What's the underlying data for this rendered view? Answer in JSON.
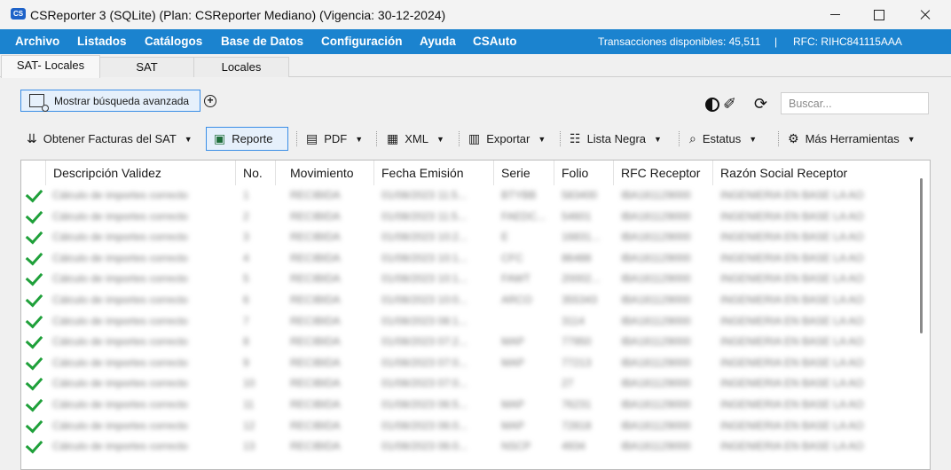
{
  "window": {
    "title": "CSReporter 3 (SQLite) (Plan: CSReporter Mediano) (Vigencia: 30-12-2024)",
    "app_icon_text": "CS"
  },
  "menu": {
    "items": [
      "Archivo",
      "Listados",
      "Catálogos",
      "Base de Datos",
      "Configuración",
      "Ayuda",
      "CSAuto"
    ],
    "transactions": "Transacciones disponibles: 45,511",
    "divider": "|",
    "rfc": "RFC: RIHC841115AAA"
  },
  "tabs": [
    "SAT- Locales",
    "SAT",
    "Locales"
  ],
  "search_row": {
    "advanced_search": "Mostrar búsqueda avanzada",
    "search_placeholder": "Buscar..."
  },
  "toolbar": {
    "items": [
      "Obtener Facturas del SAT",
      "Reporte",
      "PDF",
      "XML",
      "Exportar",
      "Lista Negra",
      "Estatus",
      "Más Herramientas"
    ]
  },
  "grid": {
    "columns": [
      "Descripción Validez",
      "No.",
      "Movimiento",
      "Fecha Emisión",
      "Serie",
      "Folio",
      "RFC Receptor",
      "Razón Social Receptor"
    ],
    "rows": [
      [
        "Cálculo de importes correcto",
        "1",
        "RECIBIDA",
        "01/08/2023 11:5...",
        "BTYBB",
        "583400",
        "IBA181129000",
        "INGENIERIA EN BASE LA AO"
      ],
      [
        "Cálculo de importes correcto",
        "2",
        "RECIBIDA",
        "01/08/2023 11:5...",
        "FAEDC...",
        "54601",
        "IBA181129000",
        "INGENIERIA EN BASE LA AO"
      ],
      [
        "Cálculo de importes correcto",
        "3",
        "RECIBIDA",
        "01/08/2023 10:2...",
        "E",
        "16831...",
        "IBA181129000",
        "INGENIERIA EN BASE LA AO"
      ],
      [
        "Cálculo de importes correcto",
        "4",
        "RECIBIDA",
        "01/08/2023 10:1...",
        "CFC",
        "86488",
        "IBA181129000",
        "INGENIERIA EN BASE LA AO"
      ],
      [
        "Cálculo de importes correcto",
        "5",
        "RECIBIDA",
        "01/08/2023 10:1...",
        "FAWT",
        "20002...",
        "IBA181129000",
        "INGENIERIA EN BASE LA AO"
      ],
      [
        "Cálculo de importes correcto",
        "6",
        "RECIBIDA",
        "01/08/2023 10:0...",
        "ARCO",
        "355343",
        "IBA181129000",
        "INGENIERIA EN BASE LA AO"
      ],
      [
        "Cálculo de importes correcto",
        "7",
        "RECIBIDA",
        "01/08/2023 08:1...",
        "",
        "3114",
        "IBA181129000",
        "INGENIERIA EN BASE LA AO"
      ],
      [
        "Cálculo de importes correcto",
        "8",
        "RECIBIDA",
        "01/08/2023 07:2...",
        "MAP",
        "77950",
        "IBA181129000",
        "INGENIERIA EN BASE LA AO"
      ],
      [
        "Cálculo de importes correcto",
        "9",
        "RECIBIDA",
        "01/08/2023 07:0...",
        "MAP",
        "77213",
        "IBA181129000",
        "INGENIERIA EN BASE LA AO"
      ],
      [
        "Cálculo de importes correcto",
        "10",
        "RECIBIDA",
        "01/08/2023 07:0...",
        "",
        "27",
        "IBA181129000",
        "INGENIERIA EN BASE LA AO"
      ],
      [
        "Cálculo de importes correcto",
        "11",
        "RECIBIDA",
        "01/08/2023 06:5...",
        "MAP",
        "76231",
        "IBA181129000",
        "INGENIERIA EN BASE LA AO"
      ],
      [
        "Cálculo de importes correcto",
        "12",
        "RECIBIDA",
        "01/08/2023 06:0...",
        "MAP",
        "72818",
        "IBA181129000",
        "INGENIERIA EN BASE LA AO"
      ],
      [
        "Cálculo de importes correcto",
        "13",
        "RECIBIDA",
        "01/08/2023 06:0...",
        "NSCP",
        "4934",
        "IBA181129000",
        "INGENIERIA EN BASE LA AO"
      ]
    ]
  }
}
